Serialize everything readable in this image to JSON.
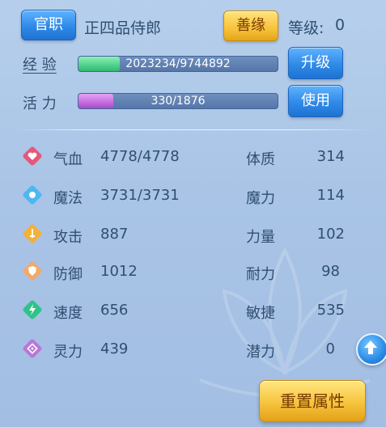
{
  "header": {
    "position_button": "官职",
    "position_title": "正四品侍郎",
    "merit_button": "善缘",
    "level_label": "等级:",
    "level_value": "0"
  },
  "exp": {
    "label": "经 验",
    "text": "2023234/9744892",
    "fraction": 0.2076,
    "button": "升级"
  },
  "vitality": {
    "label": "活 力",
    "text": "330/1876",
    "fraction": 0.176,
    "button": "使用"
  },
  "left_stats": [
    {
      "icon": "heart-icon",
      "label": "气血",
      "value": "4778/4778"
    },
    {
      "icon": "mana-icon",
      "label": "魔法",
      "value": "3731/3731"
    },
    {
      "icon": "attack-icon",
      "label": "攻击",
      "value": "887"
    },
    {
      "icon": "defense-icon",
      "label": "防御",
      "value": "1012"
    },
    {
      "icon": "speed-icon",
      "label": "速度",
      "value": "656"
    },
    {
      "icon": "spirit-icon",
      "label": "灵力",
      "value": "439"
    }
  ],
  "right_stats": [
    {
      "label": "体质",
      "value": "314"
    },
    {
      "label": "魔力",
      "value": "114"
    },
    {
      "label": "力量",
      "value": "102"
    },
    {
      "label": "耐力",
      "value": "98"
    },
    {
      "label": "敏捷",
      "value": "535"
    },
    {
      "label": "潜力",
      "value": "0"
    }
  ],
  "reset_button": "重置属性",
  "colors": {
    "exp_fill": "#4fd18a",
    "vitality_fill": "#c56be0",
    "heart": "#e4587a",
    "mana": "#4db8f0",
    "attack": "#f2b13b",
    "defense": "#f2a96a",
    "speed": "#2fc38a",
    "spirit": "#b977d8"
  }
}
